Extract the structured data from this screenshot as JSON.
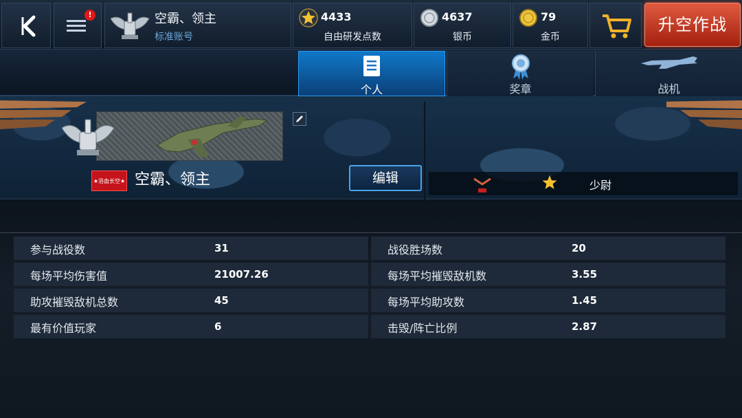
{
  "header": {
    "player_name": "空霸、领主",
    "account_type": "标准账号",
    "menu_badge": "!",
    "resources": [
      {
        "icon": "star-icon",
        "value": "4433",
        "label": "自由研发点数"
      },
      {
        "icon": "silver-coin-icon",
        "value": "4637",
        "label": "银币"
      },
      {
        "icon": "gold-coin-icon",
        "value": "79",
        "label": "金币"
      }
    ],
    "battle_button": "升空作战"
  },
  "tabs": [
    {
      "icon": "document-icon",
      "label": "个人",
      "active": true
    },
    {
      "icon": "medal-icon",
      "label": "奖章",
      "active": false
    },
    {
      "icon": "aircraft-icon",
      "label": "战机",
      "active": false
    }
  ],
  "profile": {
    "clan_tag": "★浴血长空★",
    "name": "空霸、领主",
    "edit_button": "编辑",
    "rank_label": "少尉"
  },
  "stats": {
    "left": [
      {
        "label": "参与战役数",
        "value": "31"
      },
      {
        "label": "每场平均伤害值",
        "value": "21007.26"
      },
      {
        "label": "助攻摧毁敌机总数",
        "value": "45"
      },
      {
        "label": "最有价值玩家",
        "value": "6"
      }
    ],
    "right": [
      {
        "label": "战役胜场数",
        "value": "20"
      },
      {
        "label": "每场平均摧毁敌机数",
        "value": "3.55"
      },
      {
        "label": "每场平均助攻数",
        "value": "1.45"
      },
      {
        "label": "击毁/阵亡比例",
        "value": "2.87"
      }
    ]
  },
  "colors": {
    "accent_blue": "#0f78c8",
    "battle_red": "#c0301a",
    "badge_red": "#e01818",
    "gold": "#f2c230"
  }
}
